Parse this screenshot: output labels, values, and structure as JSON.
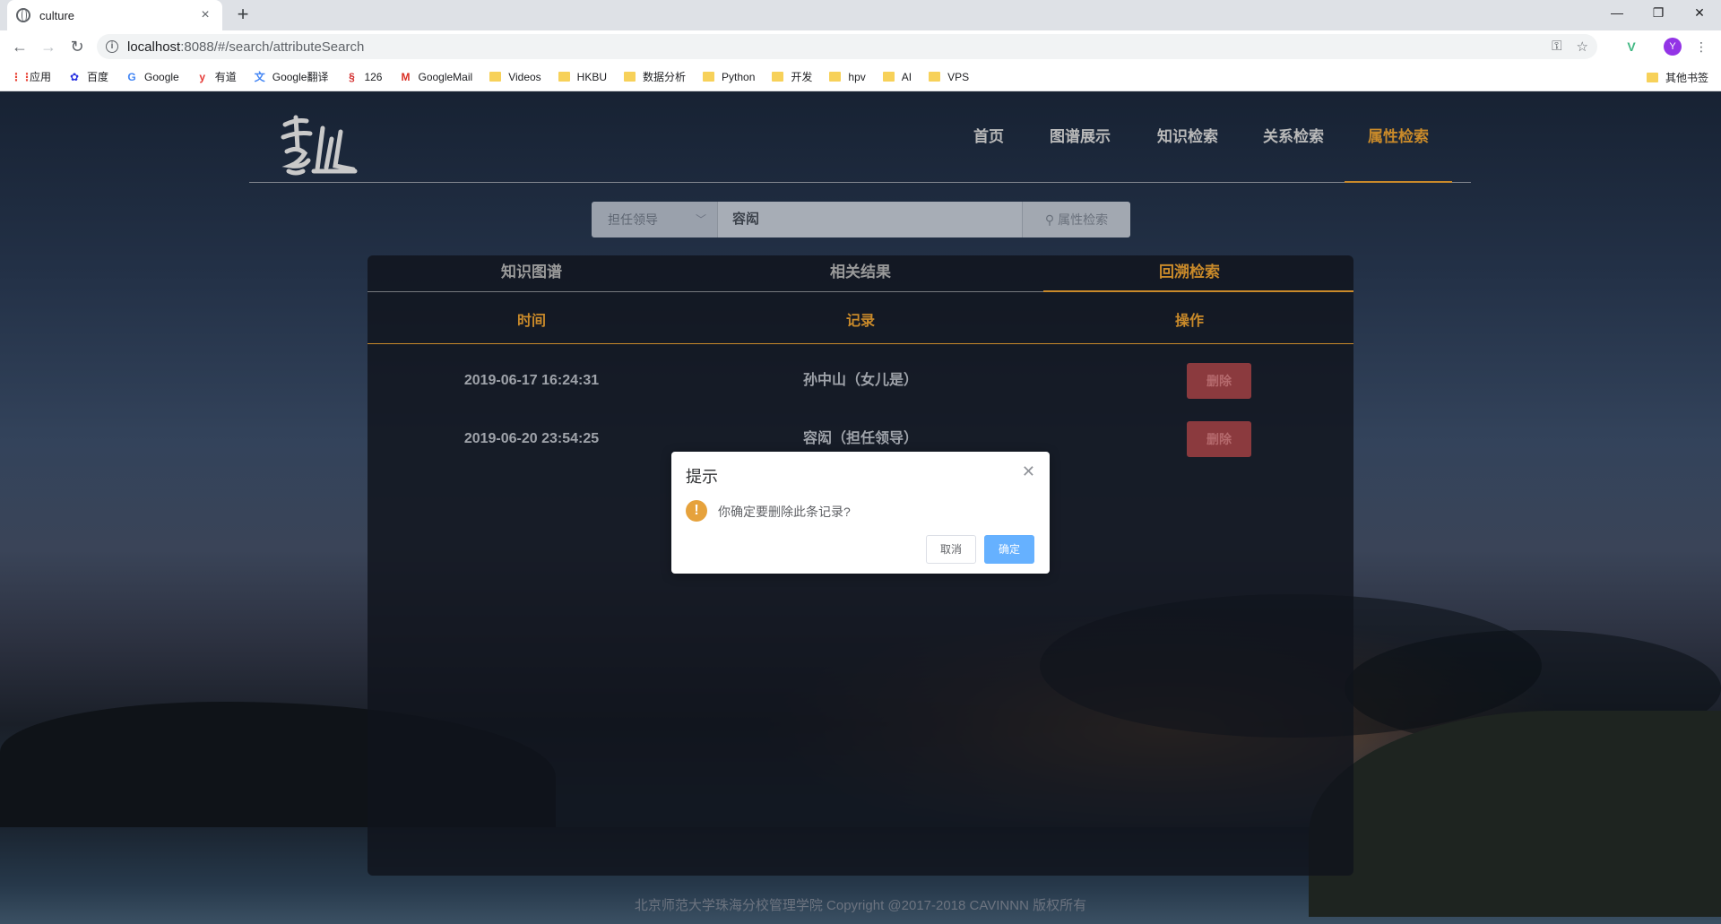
{
  "browser": {
    "tab_title": "culture",
    "url_host": "localhost",
    "url_path": ":8088/#/search/attributeSearch",
    "avatar_letter": "Y",
    "bookmarks": [
      "应用",
      "百度",
      "Google",
      "有道",
      "Google翻译",
      "126",
      "GoogleMail",
      "Videos",
      "HKBU",
      "数据分析",
      "Python",
      "开发",
      "hpv",
      "AI",
      "VPS"
    ],
    "other_bookmarks": "其他书签"
  },
  "nav": {
    "items": [
      "首页",
      "图谱展示",
      "知识检索",
      "关系检索",
      "属性检索"
    ],
    "active_index": 4
  },
  "search": {
    "attribute": "担任领导",
    "query": "容闳",
    "button_label": "属性检索"
  },
  "panel": {
    "tabs": [
      "知识图谱",
      "相关结果",
      "回溯检索"
    ],
    "active_tab": 2,
    "headers": [
      "时间",
      "记录",
      "操作"
    ],
    "rows": [
      {
        "time": "2019-06-17 16:24:31",
        "record": "孙中山（女儿是）",
        "action": "删除"
      },
      {
        "time": "2019-06-20 23:54:25",
        "record": "容闳（担任领导）",
        "action": "删除"
      }
    ]
  },
  "footer": "北京师范大学珠海分校管理学院 Copyright @2017-2018 CAVINNN 版权所有",
  "dialog": {
    "title": "提示",
    "message": "你确定要删除此条记录?",
    "cancel": "取消",
    "confirm": "确定"
  },
  "colors": {
    "accent": "#c98a2a",
    "danger": "#8b3a3e",
    "primary": "#66b1ff",
    "warning": "#e6a23c"
  }
}
